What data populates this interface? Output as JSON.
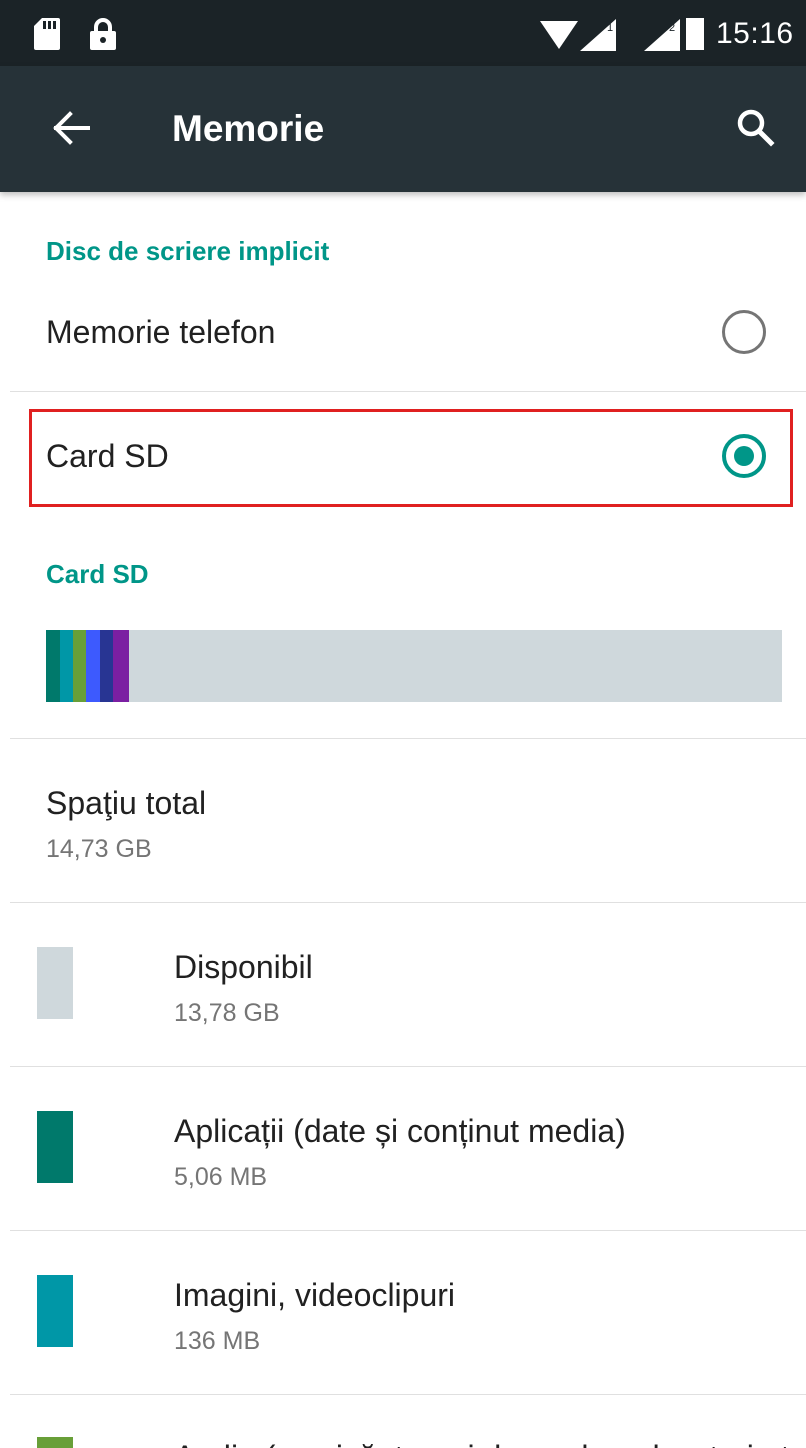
{
  "status_bar": {
    "time": "15:16",
    "icons": [
      "sd-card-icon",
      "lock-icon",
      "wifi-icon",
      "signal-sim1-icon",
      "signal-sim2-icon",
      "battery-icon"
    ]
  },
  "app_bar": {
    "title": "Memorie",
    "back_icon": "arrow-back-icon",
    "search_icon": "search-icon",
    "background": "#263238"
  },
  "default_disk": {
    "header": "Disc de scriere implicit",
    "options": [
      {
        "label": "Memorie telefon",
        "selected": false
      },
      {
        "label": "Card SD",
        "selected": true
      }
    ]
  },
  "sd_card": {
    "header": "Card SD",
    "usage_bar": {
      "background": "#cfd8dc",
      "segments": [
        {
          "color": "#00796b",
          "share": 0.019
        },
        {
          "color": "#0097a7",
          "share": 0.018
        },
        {
          "color": "#689f38",
          "share": 0.018
        },
        {
          "color": "#3d5afe",
          "share": 0.018
        },
        {
          "color": "#283593",
          "share": 0.018
        },
        {
          "color": "#7b1fa2",
          "share": 0.022
        }
      ]
    },
    "total": {
      "label": "Spaţiu total",
      "value": "14,73 GB"
    },
    "items": [
      {
        "title": "Disponibil",
        "value": "13,78 GB",
        "color": "#cfd8dc"
      },
      {
        "title": "Aplicații (date și conținut media)",
        "value": "5,06 MB",
        "color": "#00796b"
      },
      {
        "title": "Imagini, videoclipuri",
        "value": "136 MB",
        "color": "#0097a7"
      },
      {
        "title": "Audio (muzică, tonuri de apel, podcasturi etc.)",
        "value": "",
        "color": "#689f38"
      }
    ]
  },
  "accent_color": "#009688",
  "highlight_color": "#e02020"
}
